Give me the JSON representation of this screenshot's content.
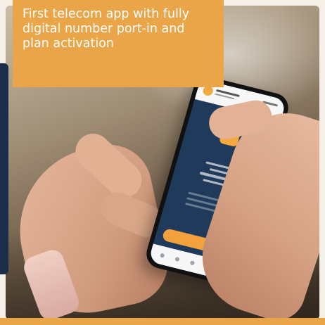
{
  "callout": {
    "text": "First telecom app with fully digital number port-in and plan activation"
  },
  "colors": {
    "accent_orange": "#e9a548",
    "navy": "#1b2d4a",
    "phone_screen": "#1f3a5a",
    "cta_orange": "#f2a13c"
  },
  "icons": {
    "app_logo": "heart-chat-icon"
  }
}
